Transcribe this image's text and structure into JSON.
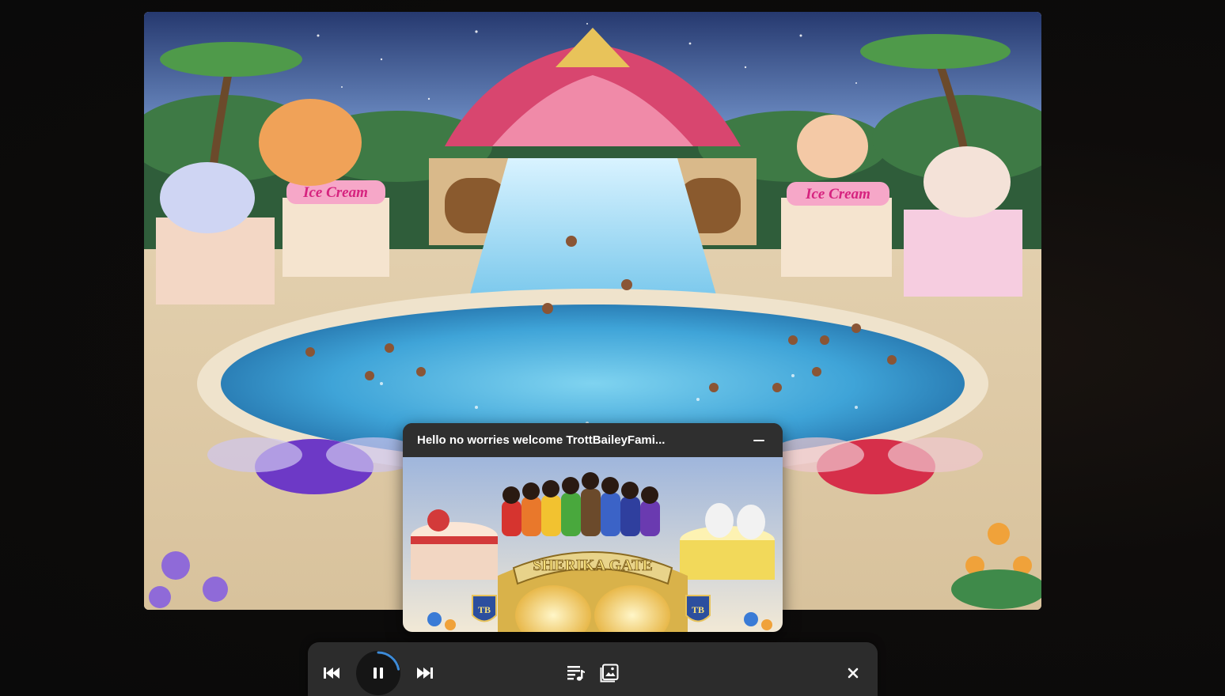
{
  "main_image": {
    "alt": "Fantasy water park with waterfall pool and ice cream stands",
    "signs": [
      "Ice Cream",
      "Ice Cream"
    ]
  },
  "mini_player": {
    "title": "Hello no worries welcome TrottBaileyFami...",
    "artwork_text": "SHERIKA GATE",
    "badge_left": "TB",
    "badge_right": "TB"
  },
  "controls": {
    "icons": [
      "previous-icon",
      "pause-icon",
      "next-icon",
      "queue-icon",
      "gallery-icon",
      "close-icon"
    ],
    "progress": 0.22
  },
  "colors": {
    "bar_bg": "#2c2c2c",
    "accent": "#3d8bd8",
    "mini_header": "#2f2f2f"
  }
}
